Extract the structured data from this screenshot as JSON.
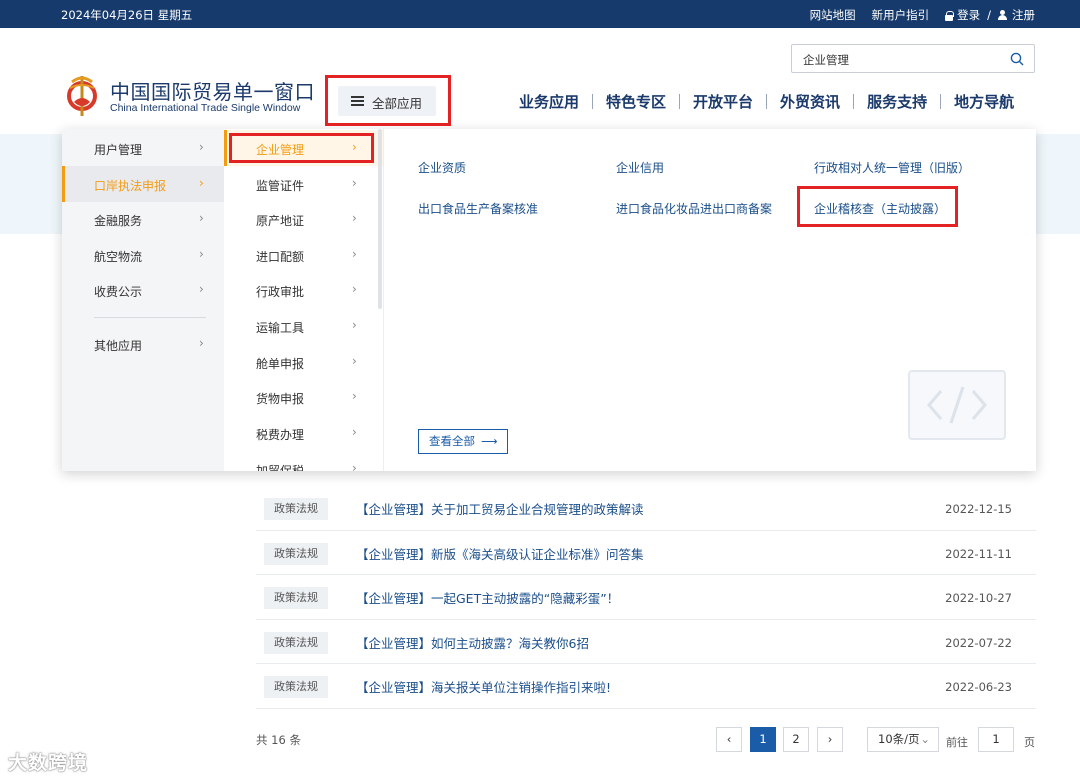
{
  "topbar": {
    "date": "2024年04月26日 星期五",
    "sitemap": "网站地图",
    "guide": "新用户指引",
    "login": "登录",
    "divider": "/",
    "register": "注册"
  },
  "header": {
    "logo_cn": "中国国际贸易单一窗口",
    "logo_en": "China International Trade Single Window",
    "search_value": "企业管理",
    "all_apps": "全部应用",
    "nav": [
      "业务应用",
      "特色专区",
      "开放平台",
      "外贸资讯",
      "服务支持",
      "地方导航"
    ]
  },
  "menu": {
    "col1": [
      "用户管理",
      "口岸执法申报",
      "金融服务",
      "航空物流",
      "收费公示",
      "其他应用"
    ],
    "col1_active": 1,
    "col2": [
      "企业管理",
      "监管证件",
      "原产地证",
      "进口配额",
      "行政审批",
      "运输工具",
      "舱单申报",
      "货物申报",
      "税费办理",
      "加贸保税"
    ],
    "col2_active": 0,
    "col3": [
      "企业资质",
      "企业信用",
      "行政相对人统一管理（旧版）",
      "出口食品生产备案核准",
      "进口食品化妆品进出口商备案",
      "企业稽核查（主动披露）"
    ],
    "view_all": "查看全部",
    "arrow": "›"
  },
  "articles": [
    {
      "tag": "政策法规",
      "title": "【企业管理】关于加工贸易企业合规管理的政策解读",
      "date": "2022-12-15"
    },
    {
      "tag": "政策法规",
      "title": "【企业管理】新版《海关高级认证企业标准》问答集",
      "date": "2022-11-11"
    },
    {
      "tag": "政策法规",
      "title": "【企业管理】一起GET主动披露的“隐藏彩蛋”！",
      "date": "2022-10-27"
    },
    {
      "tag": "政策法规",
      "title": "【企业管理】如何主动披露？海关教你6招",
      "date": "2022-07-22"
    },
    {
      "tag": "政策法规",
      "title": "【企业管理】海关报关单位注销操作指引来啦!",
      "date": "2022-06-23"
    }
  ],
  "pagination": {
    "total": "共 16 条",
    "prev": "‹",
    "pages": [
      "1",
      "2"
    ],
    "current": "1",
    "next": "›",
    "page_size": "10条/页",
    "goto_label": "前往",
    "goto_value": "1",
    "page_unit": "页"
  },
  "watermark": "大数跨境",
  "colors": {
    "topbar": "#163a6b",
    "accent_orange": "#f39c12",
    "link_blue": "#1a4e8a",
    "highlight_red": "#e32323",
    "pager_active": "#1a5ca8"
  }
}
